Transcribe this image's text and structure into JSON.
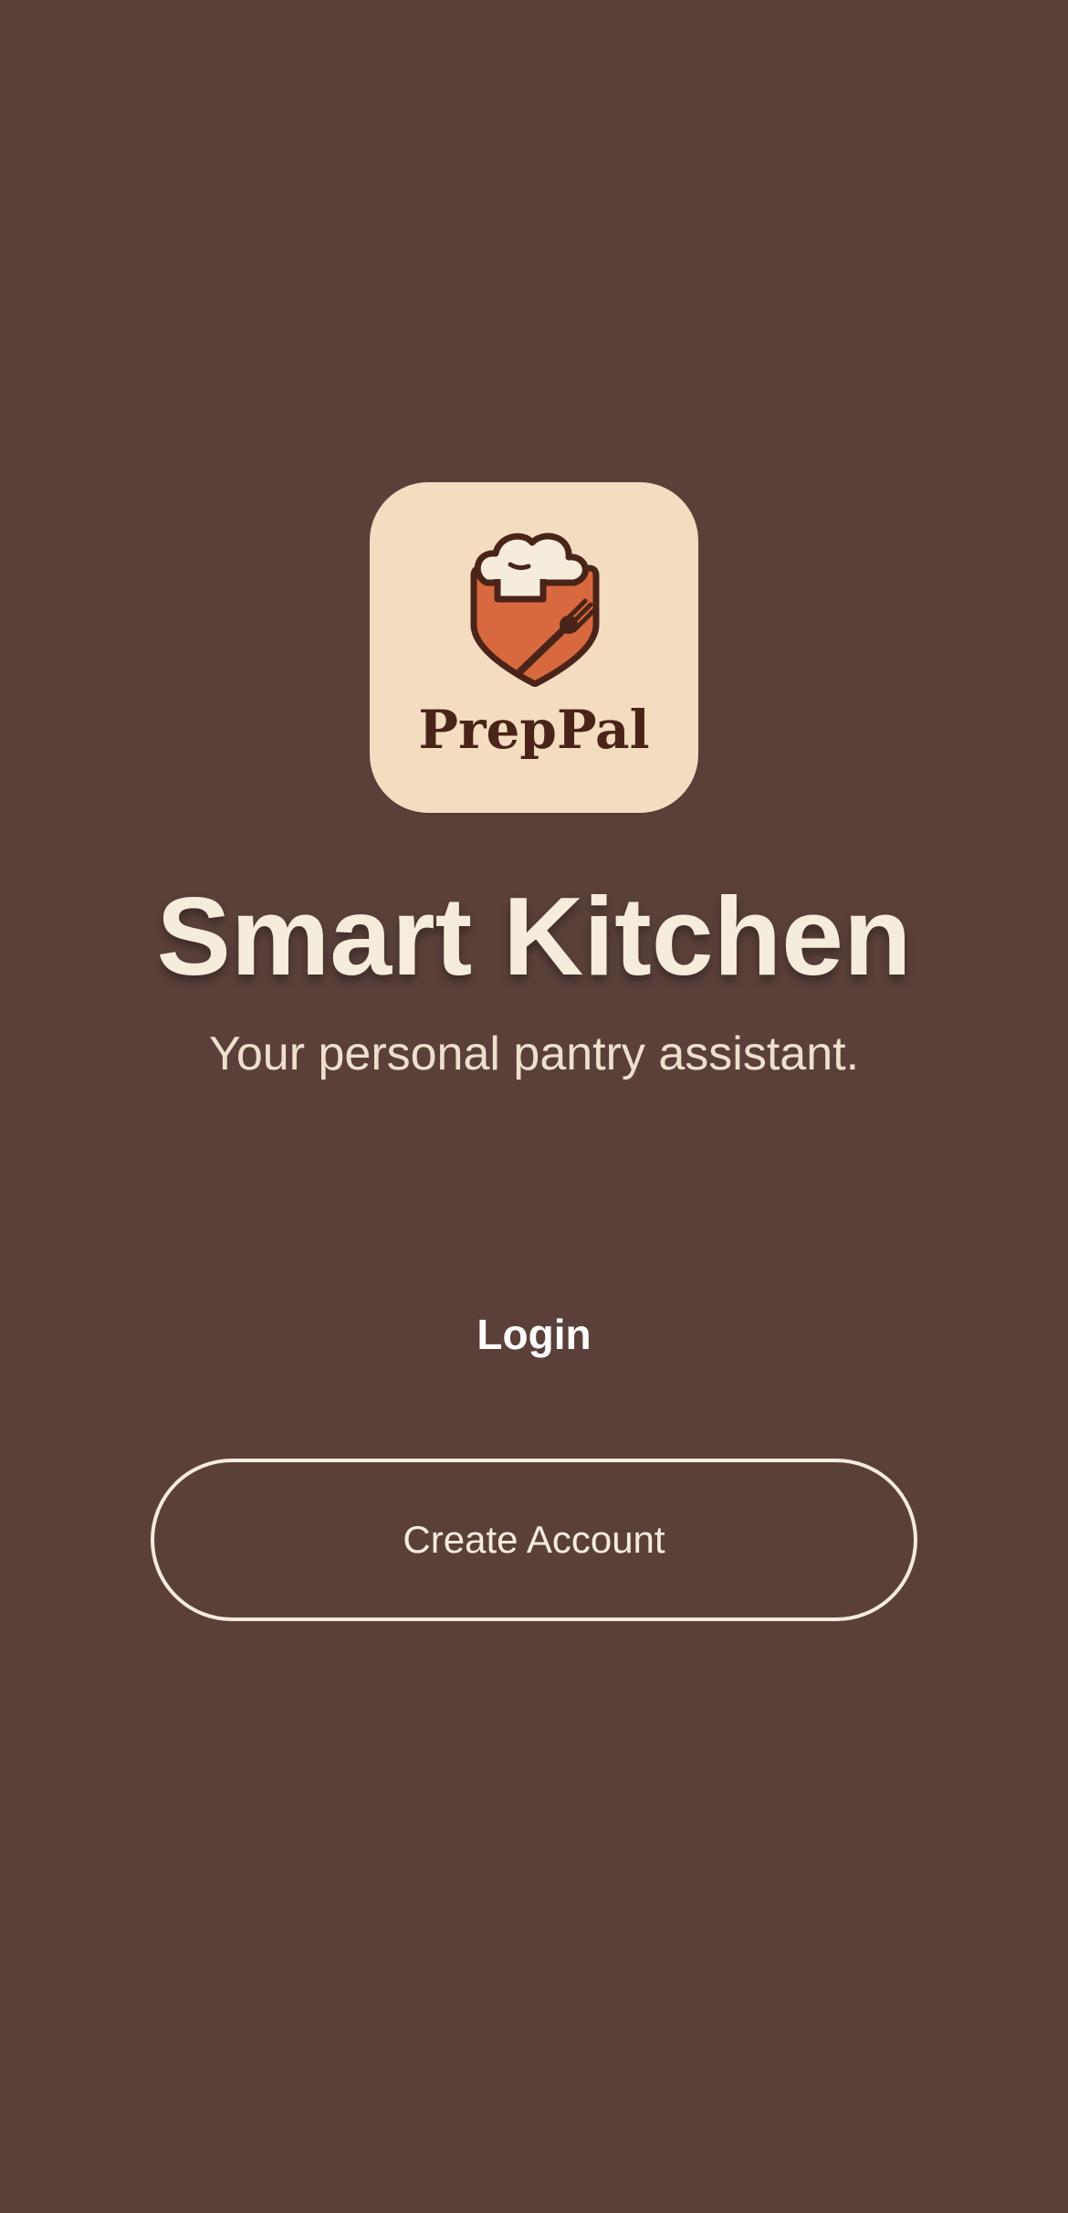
{
  "app_icon": {
    "name": "PrepPal",
    "emblem": "chef-hat-shield-fork-icon"
  },
  "welcome": {
    "headline": "Smart Kitchen",
    "subtitle": "Your personal pantry assistant."
  },
  "actions": {
    "login_label": "Login",
    "create_account_label": "Create Account"
  },
  "colors": {
    "background": "#5b403a",
    "icon_tile": "#f3dcc0",
    "accent_orange": "#d8693e",
    "dark_brown": "#4a2418",
    "text_light": "#f6ecdc"
  }
}
